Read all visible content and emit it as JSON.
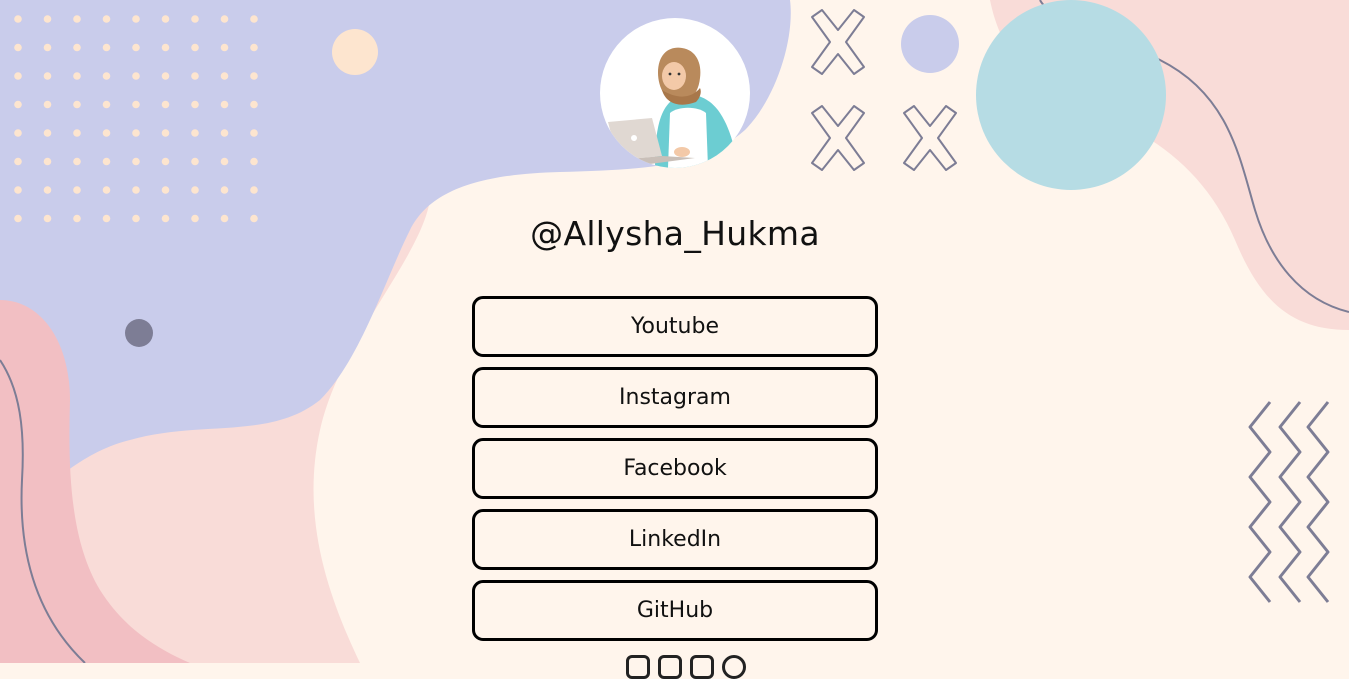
{
  "profile": {
    "handle": "@Allysha_Hukma",
    "avatar_icon": "woman-with-laptop-illustration"
  },
  "links": [
    {
      "label": "Youtube"
    },
    {
      "label": "Instagram"
    },
    {
      "label": "Facebook"
    },
    {
      "label": "LinkedIn"
    },
    {
      "label": "GitHub"
    }
  ],
  "footer_icons": [
    "mail-icon",
    "instagram-icon",
    "linkedin-icon",
    "github-icon"
  ],
  "colors": {
    "background": "#fff5ec",
    "lavender": "#c9cceb",
    "pink": "#f9dcd8",
    "rose": "#f2bfc3",
    "sky": "#b6dce4",
    "peach": "#fde5cf",
    "slate": "#7d7d95",
    "border": "#000000"
  }
}
